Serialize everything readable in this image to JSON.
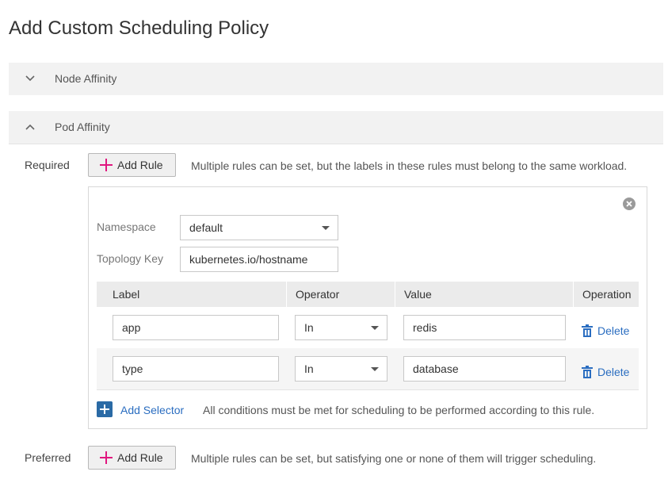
{
  "page": {
    "title": "Add Custom Scheduling Policy"
  },
  "sections": {
    "node_affinity": {
      "label": "Node Affinity",
      "expanded": false
    },
    "pod_affinity": {
      "label": "Pod Affinity",
      "expanded": true
    }
  },
  "required": {
    "label": "Required",
    "add_rule_label": "Add Rule",
    "hint": "Multiple rules can be set, but the labels in these rules must belong to the same workload."
  },
  "rule": {
    "namespace_label": "Namespace",
    "namespace_value": "default",
    "topology_label": "Topology Key",
    "topology_value": "kubernetes.io/hostname",
    "columns": [
      "Label",
      "Operator",
      "Value",
      "Operation"
    ],
    "rows": [
      {
        "label": "app",
        "operator": "In",
        "value": "redis",
        "operation": "Delete"
      },
      {
        "label": "type",
        "operator": "In",
        "value": "database",
        "operation": "Delete"
      }
    ],
    "add_selector_label": "Add Selector",
    "selector_hint": "All conditions must be met for scheduling to be performed according to this rule."
  },
  "preferred": {
    "label": "Preferred",
    "add_rule_label": "Add Rule",
    "hint": "Multiple rules can be set, but satisfying one or none of them will trigger scheduling."
  },
  "colors": {
    "accent_plus": "#e0177f",
    "link": "#2a6dc0",
    "icon_blue": "#2a6aa5"
  },
  "icons": [
    "chevron-down-icon",
    "chevron-up-icon",
    "plus-icon",
    "close-icon",
    "caret-down-icon",
    "trash-icon",
    "add-selector-icon"
  ]
}
